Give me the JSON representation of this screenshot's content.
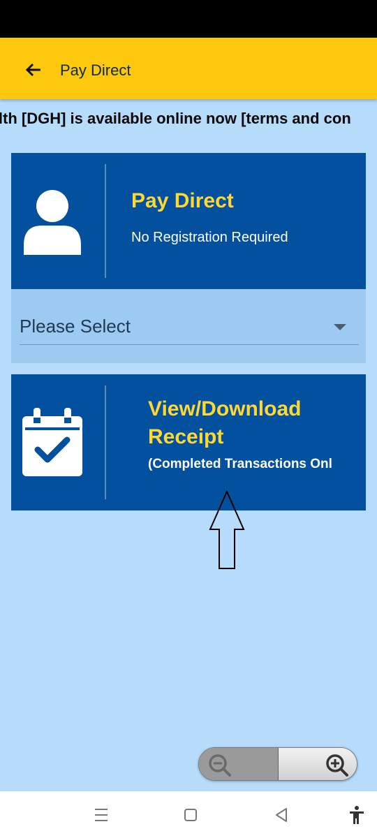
{
  "app_bar": {
    "title": "Pay Direct",
    "back_icon": "arrow-left-icon"
  },
  "marquee": {
    "text": "health [DGH] is available online now [terms and con"
  },
  "pay_direct_card": {
    "title": "Pay Direct",
    "subtitle": "No Registration Required",
    "icon": "user-icon"
  },
  "select": {
    "value": "Please Select"
  },
  "receipt_card": {
    "title": "View/Download Receipt",
    "subtitle": "(Completed Transactions Onl",
    "icon": "calendar-check-icon"
  },
  "annotation": {
    "icon": "up-arrow-annotation"
  },
  "zoom": {
    "out_icon": "zoom-out-icon",
    "in_icon": "zoom-in-icon"
  },
  "nav": {
    "items": [
      "menu-icon",
      "home-icon",
      "back-icon",
      "accessibility-icon"
    ]
  },
  "colors": {
    "app_bar": "#fdc80e",
    "background": "#b6dbfb",
    "card": "#03509e",
    "card_title": "#fdd835",
    "select_panel": "#9ccaf0"
  }
}
